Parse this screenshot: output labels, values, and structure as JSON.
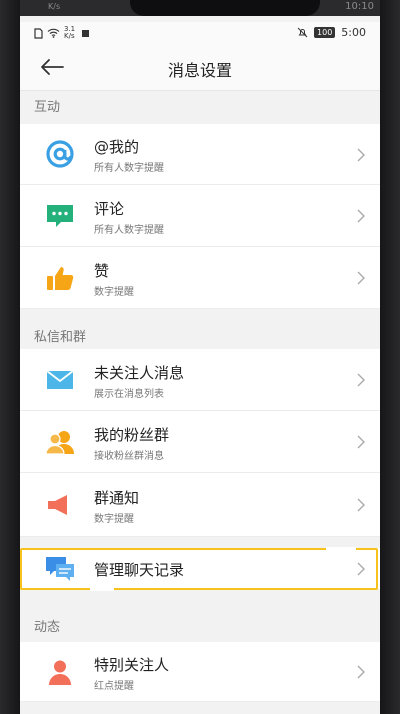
{
  "statusbar": {
    "net_speed_top": "3.1",
    "net_speed_unit": "K/s",
    "battery": "100",
    "time": "5:00",
    "ghost_time": "10:10",
    "ghost_speed": "K/s"
  },
  "header": {
    "title": "消息设置"
  },
  "sections": {
    "interaction": "互动",
    "dm_group": "私信和群",
    "dynamic": "动态"
  },
  "items": [
    {
      "title": "@我的",
      "subtitle": "所有人数字提醒"
    },
    {
      "title": "评论",
      "subtitle": "所有人数字提醒"
    },
    {
      "title": "赞",
      "subtitle": "数字提醒"
    },
    {
      "title": "未关注人消息",
      "subtitle": "展示在消息列表"
    },
    {
      "title": "我的粉丝群",
      "subtitle": "接收粉丝群消息"
    },
    {
      "title": "群通知",
      "subtitle": "数字提醒"
    },
    {
      "title": "管理聊天记录",
      "subtitle": ""
    },
    {
      "title": "特别关注人",
      "subtitle": "红点提醒"
    }
  ],
  "colors": {
    "at_icon": "#3aa0e4",
    "comment_icon": "#24b07b",
    "like_icon": "#f5a516",
    "mail_icon": "#4cb6e8",
    "fans_icon": "#f5a516",
    "notify_icon": "#f2705a",
    "chat_icon": "#3a8ee6",
    "special_icon": "#f2705a",
    "highlight": "#f6c21b"
  },
  "icons": [
    "back-arrow-icon",
    "at-icon",
    "comment-icon",
    "thumbs-up-icon",
    "mail-icon",
    "fans-group-icon",
    "megaphone-icon",
    "chat-record-icon",
    "person-icon",
    "chevron-right-icon"
  ]
}
